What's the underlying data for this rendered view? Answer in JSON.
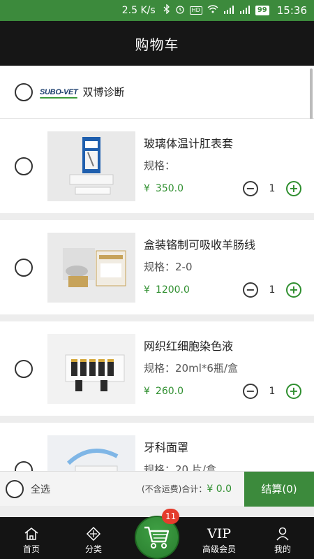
{
  "status_bar": {
    "speed": "2.5 K/s",
    "battery": "99",
    "time": "15:36",
    "icons": [
      "bluetooth-icon",
      "alarm-icon",
      "hd-icon",
      "wifi-icon",
      "signal-4g-icon",
      "signal-3g-icon",
      "battery-icon"
    ]
  },
  "header": {
    "title": "购物车"
  },
  "shop": {
    "logo_text": "SUBO-VET",
    "name": "双博诊断"
  },
  "items": [
    {
      "name": "玻璃体温计肛表套",
      "spec": "规格：",
      "currency": "¥",
      "price": "350.0",
      "qty": "1"
    },
    {
      "name": "盒装铬制可吸收羊肠线",
      "spec": "规格：2-0",
      "currency": "¥",
      "price": "1200.0",
      "qty": "1"
    },
    {
      "name": "网织红细胞染色液",
      "spec": "规格：20ml*6瓶/盒",
      "currency": "¥",
      "price": "260.0",
      "qty": "1"
    },
    {
      "name": "牙科面罩",
      "spec": "规格：20 片/盒",
      "currency": "¥",
      "price": "",
      "qty": ""
    }
  ],
  "footer": {
    "select_all": "全选",
    "total_label": "(不含运费)合计：",
    "total_amount": "¥ 0.0",
    "checkout": "结算(0)"
  },
  "tabbar": {
    "home": "首页",
    "category": "分类",
    "vip_glyph": "VIP",
    "vip": "高级会员",
    "mine": "我的",
    "cart_badge": "11"
  },
  "colors": {
    "accent": "#3c8a3c",
    "price": "#2f8f2f",
    "header": "#161616",
    "badge": "#e43c2c"
  }
}
